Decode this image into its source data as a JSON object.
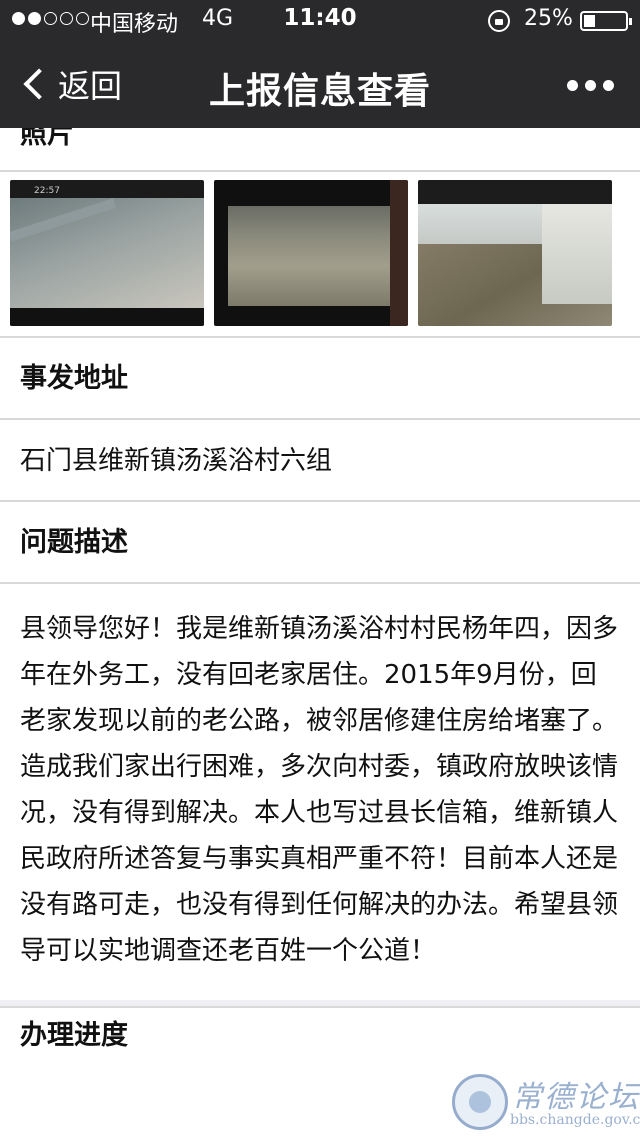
{
  "status_bar": {
    "carrier": "中国移动",
    "network": "4G",
    "time": "11:40",
    "battery": "25%",
    "signal_bars_filled": 2,
    "signal_bars_total": 5
  },
  "nav": {
    "back_label": "返回",
    "title": "上报信息查看",
    "more_icon": "more-dots-icon"
  },
  "sections": {
    "photos_label": "照片",
    "address_label": "事发地址",
    "address_value": "石门县维新镇汤溪浴村六组",
    "description_label": "问题描述",
    "description_text": "县领导您好！我是维新镇汤溪浴村村民杨年四，因多年在外务工，没有回老家居住。2015年9月份，回老家发现以前的老公路，被邻居修建住房给堵塞了。造成我们家出行困难，多次向村委，镇政府放映该情况，没有得到解决。本人也写过县长信箱，维新镇人民政府所述答复与事实真相严重不符！目前本人还是没有路可走，也没有得到任何解决的办法。希望县领导可以实地调查还老百姓一个公道！",
    "progress_label": "办理进度"
  },
  "photos": [
    {
      "name": "road-photo",
      "timestamp": "22:57"
    },
    {
      "name": "blocked-road-photo"
    },
    {
      "name": "house-yard-photo"
    }
  ],
  "watermark": {
    "title": "常德论坛",
    "url": "bbs.changde.gov.cn"
  }
}
